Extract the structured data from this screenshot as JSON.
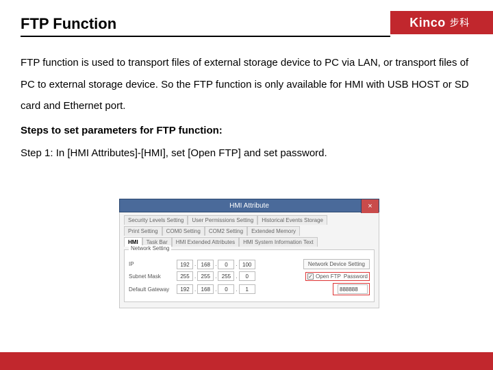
{
  "brand": {
    "name": "Kinco",
    "cjk": "步科"
  },
  "title": "FTP Function",
  "paragraph": "FTP function is used to transport files of external storage device to PC via LAN, or transport files of PC to external storage device. So the FTP function is only available for HMI with USB HOST or SD card and Ethernet port.",
  "steps_heading": "Steps to set parameters for FTP function:",
  "step1": "Step 1: In [HMI Attributes]-[HMI], set [Open FTP] and set password.",
  "dialog": {
    "title": "HMI Attribute",
    "tabs_row1": [
      "Security Levels Setting",
      "User Permissions Setting",
      "Historical Events Storage"
    ],
    "tabs_row2": [
      "Print Setting",
      "COM0 Setting",
      "COM2 Setting",
      "Extended Memory"
    ],
    "tabs_row3": [
      "HMI",
      "Task Bar",
      "HMI Extended Attributes",
      "HMI System Information Text"
    ],
    "active_tab": "HMI",
    "group_label": "Network Setting",
    "fields": {
      "ip_label": "IP",
      "ip": [
        "192",
        "168",
        "0",
        "100"
      ],
      "net_device_btn": "Network Device Setting",
      "subnet_label": "Subnet Mask",
      "subnet": [
        "255",
        "255",
        "255",
        "0"
      ],
      "open_ftp_label": "Open FTP",
      "password_label": "Password",
      "password_value": "888888",
      "gateway_label": "Default Gateway",
      "gateway": [
        "192",
        "168",
        "0",
        "1"
      ]
    }
  }
}
